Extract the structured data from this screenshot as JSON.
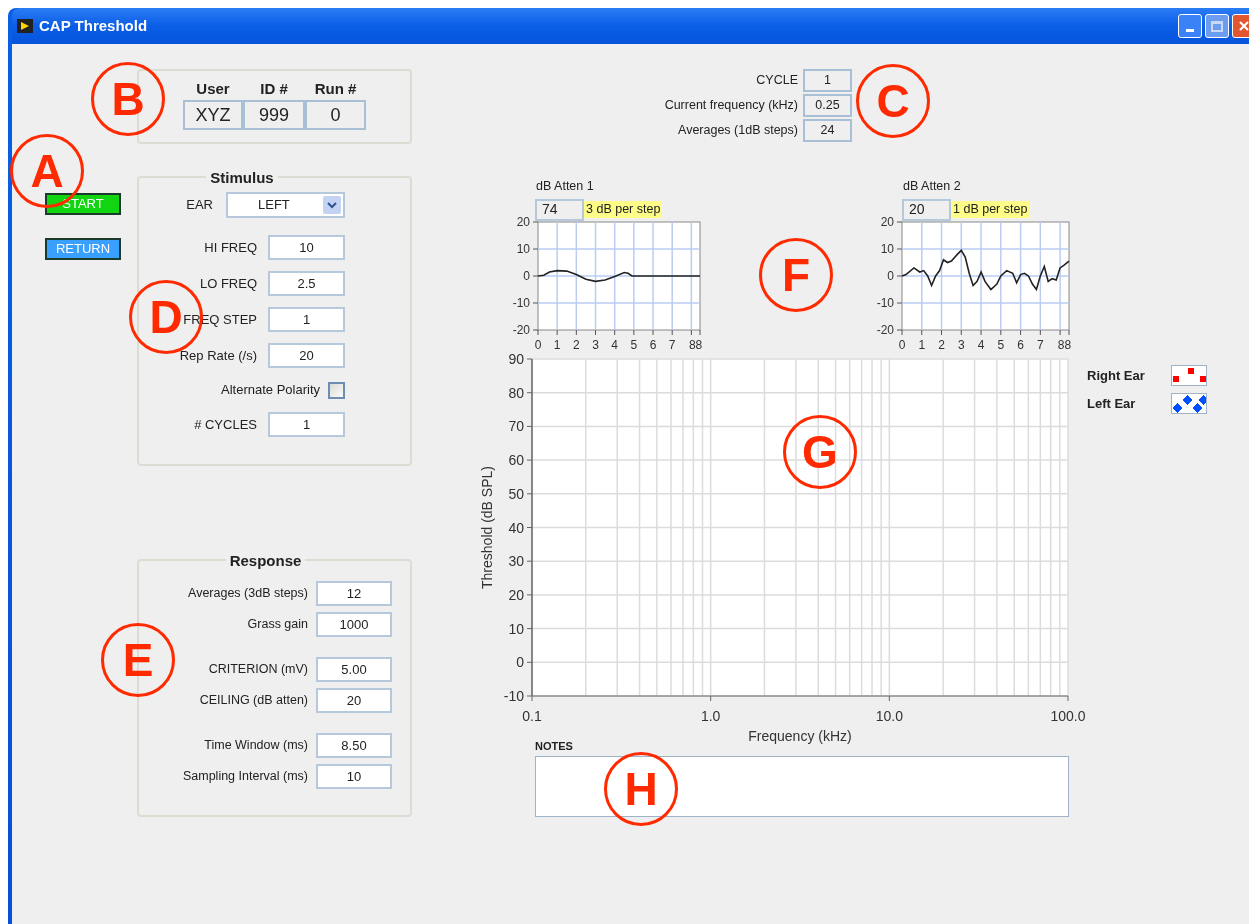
{
  "window": {
    "title": "CAP Threshold"
  },
  "buttons": [
    {
      "label": "START",
      "kind": "start"
    },
    {
      "label": "RETURN",
      "kind": "return"
    }
  ],
  "session": {
    "columns": [
      "User",
      "ID #",
      "Run #"
    ],
    "values": [
      "XYZ",
      "999",
      "0"
    ]
  },
  "status": [
    {
      "label": "CYCLE",
      "value": "1"
    },
    {
      "label": "Current frequency (kHz)",
      "value": "0.25"
    },
    {
      "label": "Averages (1dB steps)",
      "value": "24"
    }
  ],
  "stimulus": {
    "title": "Stimulus",
    "ear": {
      "label": "EAR",
      "value": "LEFT"
    },
    "fields": [
      {
        "kind": "number",
        "label": "HI FREQ",
        "value": "10"
      },
      {
        "kind": "number",
        "label": "LO FREQ",
        "value": "2.5"
      },
      {
        "kind": "number",
        "label": "FREQ STEP",
        "value": "1"
      },
      {
        "kind": "number",
        "label": "Rep Rate (/s)",
        "value": "20"
      },
      {
        "kind": "checkbox",
        "label": "Alternate Polarity",
        "checked": false
      },
      {
        "kind": "number",
        "label": "# CYCLES",
        "value": "1"
      }
    ]
  },
  "response": {
    "title": "Response",
    "groups": [
      [
        {
          "label": "Averages (3dB steps)",
          "value": "12"
        },
        {
          "label": "Grass gain",
          "value": "1000"
        }
      ],
      [
        {
          "label": "CRITERION (mV)",
          "value": "5.00"
        },
        {
          "label": "CEILING (dB atten)",
          "value": "20"
        }
      ],
      [
        {
          "label": "Time Window (ms)",
          "value": "8.50"
        },
        {
          "label": "Sampling Interval (ms)",
          "value": "10"
        }
      ]
    ]
  },
  "attenuators": [
    {
      "label": "dB Atten 1",
      "value": "74",
      "step": "3 dB per step",
      "kind": "smooth",
      "y_ticks": [
        "20",
        "10",
        "0",
        "-10",
        "-20"
      ],
      "x_ticks": [
        "0",
        "1",
        "2",
        "3",
        "4",
        "5",
        "6",
        "7",
        "88"
      ]
    },
    {
      "label": "dB Atten 2",
      "value": "20",
      "step": "1 dB per step",
      "kind": "noisy",
      "y_ticks": [
        "20",
        "10",
        "0",
        "-10",
        "-20"
      ],
      "x_ticks": [
        "0",
        "1",
        "2",
        "3",
        "4",
        "5",
        "6",
        "7",
        "88"
      ]
    }
  ],
  "threshold_chart": {
    "xlabel": "Frequency (kHz)",
    "ylabel": "Threshold (dB SPL)",
    "x_ticks": [
      "0.1",
      "1.0",
      "10.0",
      "100.0"
    ],
    "y_ticks": [
      "90",
      "80",
      "70",
      "60",
      "50",
      "40",
      "30",
      "20",
      "10",
      "0",
      "-10"
    ]
  },
  "legend": [
    {
      "label": "Right Ear",
      "color": "#ff0000",
      "kind": "square"
    },
    {
      "label": "Left Ear",
      "color": "#0050ff",
      "kind": "diamond"
    }
  ],
  "notes": {
    "label": "NOTES"
  },
  "annotations": [
    {
      "letter": "A"
    },
    {
      "letter": "B"
    },
    {
      "letter": "C"
    },
    {
      "letter": "D"
    },
    {
      "letter": "E"
    },
    {
      "letter": "F"
    },
    {
      "letter": "G"
    },
    {
      "letter": "H"
    }
  ]
}
